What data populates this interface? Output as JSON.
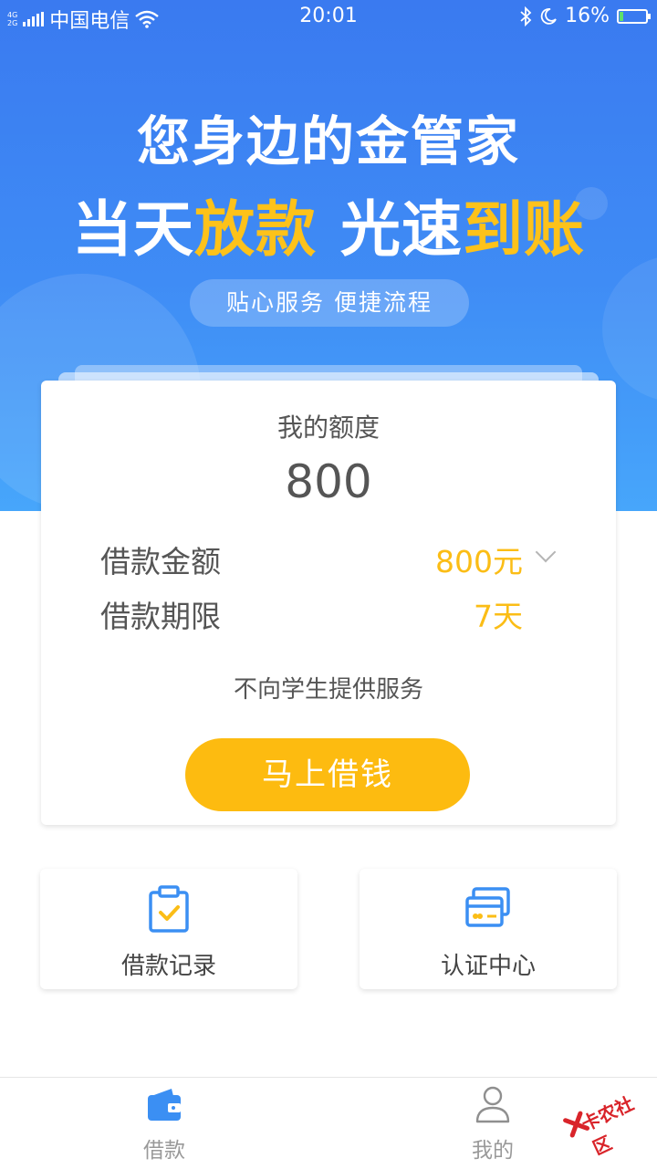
{
  "status_bar": {
    "network_tag_top": "4G",
    "network_tag_bottom": "2G",
    "carrier": "中国电信",
    "time": "20:01",
    "battery_percent": "16%",
    "battery_level": 0.16,
    "battery_fill_color": "#5ee06a"
  },
  "hero": {
    "headline_line1": "您身边的金管家",
    "headline_line2_part1": "当天",
    "headline_line2_part2": "放款",
    "headline_line2_part3": "光速",
    "headline_line2_part4": "到账",
    "tagline": "贴心服务  便捷流程"
  },
  "card": {
    "quota_label": "我的额度",
    "quota_amount": "800",
    "amount_label": "借款金额",
    "amount_value": "800元",
    "term_label": "借款期限",
    "term_value": "7天",
    "notice": "不向学生提供服务",
    "borrow_button": "马上借钱"
  },
  "quick_actions": [
    {
      "label": "借款记录",
      "icon": "clipboard-check-icon"
    },
    {
      "label": "认证中心",
      "icon": "credit-card-icon"
    }
  ],
  "tabbar": {
    "items": [
      {
        "label": "借款",
        "icon": "wallet-icon"
      },
      {
        "label": "我的",
        "icon": "user-icon"
      }
    ]
  },
  "watermark": {
    "text": "卡农社区"
  },
  "colors": {
    "hero_blue": "#3a7af0",
    "accent_yellow": "#fdbb10",
    "text_gray": "#555555",
    "icon_blue": "#3b8ff3"
  }
}
